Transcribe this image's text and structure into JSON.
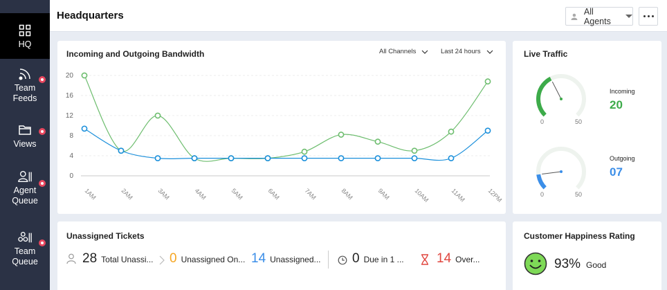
{
  "sidebar": {
    "items": [
      {
        "label": "HQ",
        "icon": "grid-icon"
      },
      {
        "label": "Team\nFeeds",
        "icon": "feeds-icon"
      },
      {
        "label": "Views",
        "icon": "folder-icon"
      },
      {
        "label": "Agent\nQueue",
        "icon": "agent-icon"
      },
      {
        "label": "Team\nQueue",
        "icon": "team-icon"
      }
    ]
  },
  "header": {
    "title": "Headquarters",
    "agents_filter": "All Agents"
  },
  "bandwidth": {
    "title": "Incoming and Outgoing Bandwidth",
    "channel_filter": "All Channels",
    "time_filter": "Last 24 hours"
  },
  "chart_data": {
    "type": "line",
    "title": "Incoming and Outgoing Bandwidth",
    "categories": [
      "1AM",
      "2AM",
      "3AM",
      "4AM",
      "5AM",
      "6AM",
      "7AM",
      "8AM",
      "9AM",
      "10AM",
      "11AM",
      "12PM"
    ],
    "yticks": [
      "0",
      "4",
      "8",
      "12",
      "16",
      "20"
    ],
    "ylim": [
      0,
      20
    ],
    "grid": true,
    "series": [
      {
        "values": [
          20,
          5,
          12,
          3.5,
          3.5,
          3.5,
          4.8,
          8.2,
          6.8,
          5,
          8.8,
          18.8
        ],
        "color": "#6dbd6e"
      },
      {
        "values": [
          9.4,
          5,
          3.5,
          3.5,
          3.5,
          3.5,
          3.5,
          3.5,
          3.5,
          3.5,
          3.5,
          9
        ],
        "color": "#1a8fdb"
      }
    ]
  },
  "live_traffic": {
    "title": "Live Traffic",
    "incoming": {
      "label": "Incoming",
      "value": "20",
      "min": "0",
      "max": "50",
      "level": 20,
      "color": "#3dab4a"
    },
    "outgoing": {
      "label": "Outgoing",
      "value": "07",
      "min": "0",
      "max": "50",
      "level": 7,
      "color": "#3b8ee8"
    }
  },
  "tickets": {
    "title": "Unassigned Tickets",
    "total": {
      "num": "28",
      "label": "Total Unassi..."
    },
    "unassigned_on": {
      "num": "0",
      "label": "Unassigned On...",
      "color": "#f5a623"
    },
    "unassigned_2": {
      "num": "14",
      "label": "Unassigned...",
      "color": "#3b8ee8"
    },
    "due": {
      "num": "0",
      "label": "Due in 1 ..."
    },
    "overdue": {
      "num": "14",
      "label": "Over...",
      "color": "#e0463f"
    }
  },
  "happiness": {
    "title": "Customer Happiness Rating",
    "percent": "93%",
    "label": "Good"
  }
}
